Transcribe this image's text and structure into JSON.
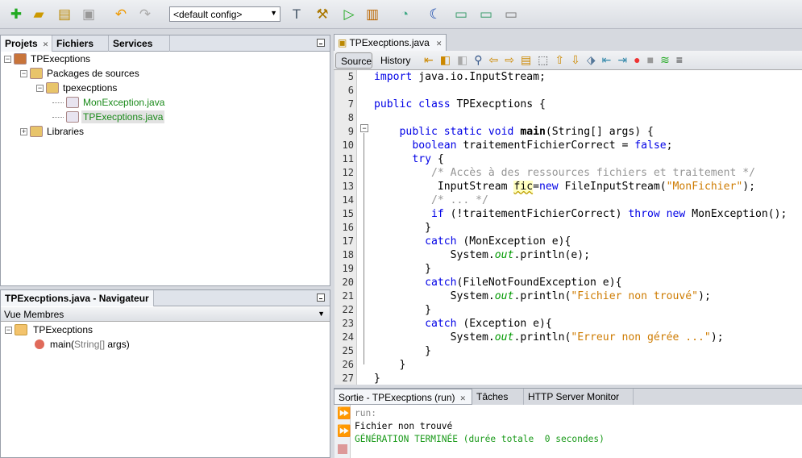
{
  "toolbar": {
    "config": "<default config>",
    "icons": [
      "new-file-icon",
      "new-project-icon",
      "open-project-icon",
      "save-all-icon",
      "undo-icon",
      "redo-icon",
      "build-icon",
      "clean-build-icon",
      "run-icon",
      "debug-icon",
      "profile-icon",
      "apply-changes-icon",
      "screen-icon-1",
      "screen-icon-2",
      "screen-icon-3"
    ]
  },
  "projects": {
    "tabs": [
      "Projets",
      "Fichiers",
      "Services"
    ],
    "tree": [
      {
        "label": "TPExecptions",
        "level": 0,
        "exp": "-",
        "color": "#000",
        "icon": "project-icon"
      },
      {
        "label": "Packages de sources",
        "level": 1,
        "exp": "-",
        "color": "#000",
        "icon": "source-packages-icon"
      },
      {
        "label": "tpexecptions",
        "level": 2,
        "exp": "-",
        "color": "#000",
        "icon": "package-icon"
      },
      {
        "label": "MonException.java",
        "level": 3,
        "exp": "",
        "color": "#1a8a1a",
        "icon": "java-file-icon"
      },
      {
        "label": "TPExecptions.java",
        "level": 3,
        "exp": "",
        "color": "#1a8a1a",
        "icon": "java-main-file-icon",
        "selected": true
      },
      {
        "label": "Libraries",
        "level": 1,
        "exp": "+",
        "color": "#000",
        "icon": "libraries-icon"
      }
    ]
  },
  "navigator": {
    "title": "TPExecptions.java - Navigateur",
    "view": "Vue Membres",
    "class_name": "TPExecptions",
    "method_name": "main(",
    "method_param": "String[]",
    "method_rest": " args)"
  },
  "editor": {
    "tab": "TPExecptions.java",
    "source": "Source",
    "history": "History",
    "lines": [
      {
        "n": "5",
        "t": [
          [
            "plain",
            ""
          ],
          [
            "kw",
            "import"
          ],
          [
            "plain",
            " java.io.InputStream;"
          ]
        ]
      },
      {
        "n": "6",
        "t": []
      },
      {
        "n": "7",
        "t": [
          [
            "kw",
            "public class"
          ],
          [
            "plain",
            " TPExecptions {"
          ]
        ]
      },
      {
        "n": "8",
        "t": []
      },
      {
        "n": "9",
        "t": [
          [
            "plain",
            "    "
          ],
          [
            "kw",
            "public static void"
          ],
          [
            "plain",
            " "
          ],
          [
            "mth",
            "main"
          ],
          [
            "plain",
            "(String[] args) {"
          ]
        ]
      },
      {
        "n": "10",
        "t": [
          [
            "plain",
            "      "
          ],
          [
            "kw",
            "boolean"
          ],
          [
            "plain",
            " traitementFichierCorrect = "
          ],
          [
            "kw",
            "false"
          ],
          [
            "plain",
            ";"
          ]
        ]
      },
      {
        "n": "11",
        "t": [
          [
            "plain",
            "      "
          ],
          [
            "kw",
            "try"
          ],
          [
            "plain",
            " {"
          ]
        ]
      },
      {
        "n": "12",
        "t": [
          [
            "plain",
            "         "
          ],
          [
            "cm",
            "/* Accès à des ressources fichiers et traitement */"
          ]
        ]
      },
      {
        "n": "13",
        "t": [
          [
            "plain",
            "          InputStream "
          ],
          [
            "hl",
            "fic"
          ],
          [
            "plain",
            "="
          ],
          [
            "kw",
            "new"
          ],
          [
            "plain",
            " FileInputStream("
          ],
          [
            "str",
            "\"MonFichier\""
          ],
          [
            "plain",
            ");"
          ]
        ]
      },
      {
        "n": "14",
        "t": [
          [
            "plain",
            "         "
          ],
          [
            "cm",
            "/* ... */"
          ]
        ]
      },
      {
        "n": "15",
        "t": [
          [
            "plain",
            "         "
          ],
          [
            "kw",
            "if"
          ],
          [
            "plain",
            " (!traitementFichierCorrect) "
          ],
          [
            "kw",
            "throw new"
          ],
          [
            "plain",
            " MonException();"
          ]
        ]
      },
      {
        "n": "16",
        "t": [
          [
            "plain",
            "        }"
          ]
        ]
      },
      {
        "n": "17",
        "t": [
          [
            "plain",
            "        "
          ],
          [
            "kw",
            "catch"
          ],
          [
            "plain",
            " (MonException e){"
          ]
        ]
      },
      {
        "n": "18",
        "t": [
          [
            "plain",
            "            System."
          ],
          [
            "fld",
            "out"
          ],
          [
            "plain",
            ".println(e);"
          ]
        ]
      },
      {
        "n": "19",
        "t": [
          [
            "plain",
            "        }"
          ]
        ]
      },
      {
        "n": "20",
        "t": [
          [
            "plain",
            "        "
          ],
          [
            "kw",
            "catch"
          ],
          [
            "plain",
            "(FileNotFoundException e){"
          ]
        ]
      },
      {
        "n": "21",
        "t": [
          [
            "plain",
            "            System."
          ],
          [
            "fld",
            "out"
          ],
          [
            "plain",
            ".println("
          ],
          [
            "str",
            "\"Fichier non trouvé\""
          ],
          [
            "plain",
            ");"
          ]
        ]
      },
      {
        "n": "22",
        "t": [
          [
            "plain",
            "        }"
          ]
        ]
      },
      {
        "n": "23",
        "t": [
          [
            "plain",
            "        "
          ],
          [
            "kw",
            "catch"
          ],
          [
            "plain",
            " (Exception e){"
          ]
        ]
      },
      {
        "n": "24",
        "t": [
          [
            "plain",
            "            System."
          ],
          [
            "fld",
            "out"
          ],
          [
            "plain",
            ".println("
          ],
          [
            "str",
            "\"Erreur non gérée ...\""
          ],
          [
            "plain",
            ");"
          ]
        ]
      },
      {
        "n": "25",
        "t": [
          [
            "plain",
            "        }"
          ]
        ]
      },
      {
        "n": "26",
        "t": [
          [
            "plain",
            "    }"
          ]
        ]
      },
      {
        "n": "27",
        "t": [
          [
            "plain",
            "}"
          ]
        ]
      }
    ]
  },
  "output": {
    "tabs": [
      "Sortie - TPExecptions (run)",
      "Tâches",
      "HTTP Server Monitor"
    ],
    "lines": [
      {
        "text": "run:",
        "color": "#888888"
      },
      {
        "text": "Fichier non trouvé",
        "color": "#000000"
      },
      {
        "text": "GÉNÉRATION TERMINÉE (durée totale  0 secondes)",
        "color": "#1a9a1a"
      }
    ]
  }
}
